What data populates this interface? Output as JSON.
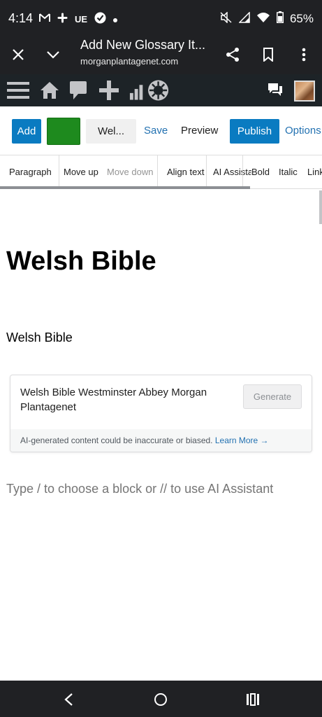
{
  "status": {
    "time": "4:14",
    "left_icons": [
      "gmail-icon",
      "slack-icon",
      "UE",
      "check-circle-icon",
      "dot-icon"
    ],
    "ue_label": "UE",
    "battery": "65%"
  },
  "browser": {
    "title": "Add New Glossary It...",
    "url": "morganplantagenet.com"
  },
  "toolbar": {
    "add_label": "Add",
    "doc_label": "Wel...",
    "save_label": "Save",
    "preview_label": "Preview",
    "publish_label": "Publish",
    "options_label": "Options",
    "swatch_color": "#1e8a1e",
    "accent_color": "#0a7bc1"
  },
  "block_toolbar": {
    "items": [
      "Paragraph",
      "Move up",
      "Move down",
      "Align text",
      "AI Assistant",
      "Bold",
      "Italic",
      "Link"
    ]
  },
  "content": {
    "title": "Welsh Bible",
    "paragraph": "Welsh Bible",
    "ai": {
      "prompt": "Welsh Bible Westminster Abbey Morgan Plantagenet",
      "generate_label": "Generate",
      "disclaimer": "AI-generated content could be inaccurate or biased.",
      "learn_more": "Learn More →"
    },
    "placeholder": "Type / to choose a block or // to use AI Assistant"
  }
}
